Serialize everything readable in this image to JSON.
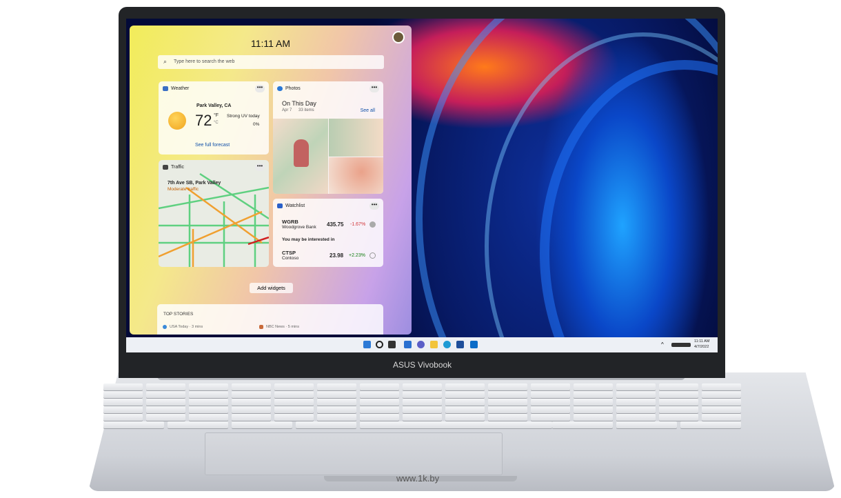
{
  "device": {
    "brand": "ASUS Vivobook",
    "watermark": "www.1k.by"
  },
  "widgets": {
    "time": "11:11 AM",
    "search_placeholder": "Type here to search the web",
    "weather": {
      "title": "Weather",
      "location": "Park Valley, CA",
      "temp": "72",
      "unit_f": "°F",
      "unit_c": "°C",
      "uv": "Strong UV today",
      "precip": "0%",
      "link": "See full forecast"
    },
    "photos": {
      "title": "Photos",
      "heading": "On This Day",
      "date": "Apr 7",
      "count": "33 items",
      "see_all": "See all"
    },
    "traffic": {
      "title": "Traffic",
      "road": "7th Ave SB, Park Valley",
      "status": "Moderate traffic"
    },
    "watchlist": {
      "title": "Watchlist",
      "stocks": [
        {
          "symbol": "WGRB",
          "name": "Woodgrove Bank",
          "price": "435.75",
          "change": "-1.67%"
        },
        {
          "symbol": "CTSP",
          "name": "Contoso",
          "price": "23.98",
          "change": "+2.23%"
        }
      ],
      "interested": "You may be interested in"
    },
    "add_widgets": "Add widgets",
    "top_stories": {
      "title": "TOP STORIES",
      "sources": [
        "USA Today · 3 mins",
        "NBC News · 5 mins"
      ]
    },
    "more": "•••"
  },
  "taskbar": {
    "icons": [
      "start-icon",
      "search-icon",
      "task-view-icon",
      "widgets-icon",
      "chat-icon",
      "file-explorer-icon",
      "edge-icon",
      "store-icon",
      "outlook-icon"
    ],
    "tray_chevron": "^",
    "clock_time": "11:11 AM",
    "clock_date": "4/7/2022"
  },
  "colors": {
    "negative": "#d13438",
    "positive": "#107c10",
    "link": "#0f4fa8",
    "traffic": "#c25e00"
  }
}
